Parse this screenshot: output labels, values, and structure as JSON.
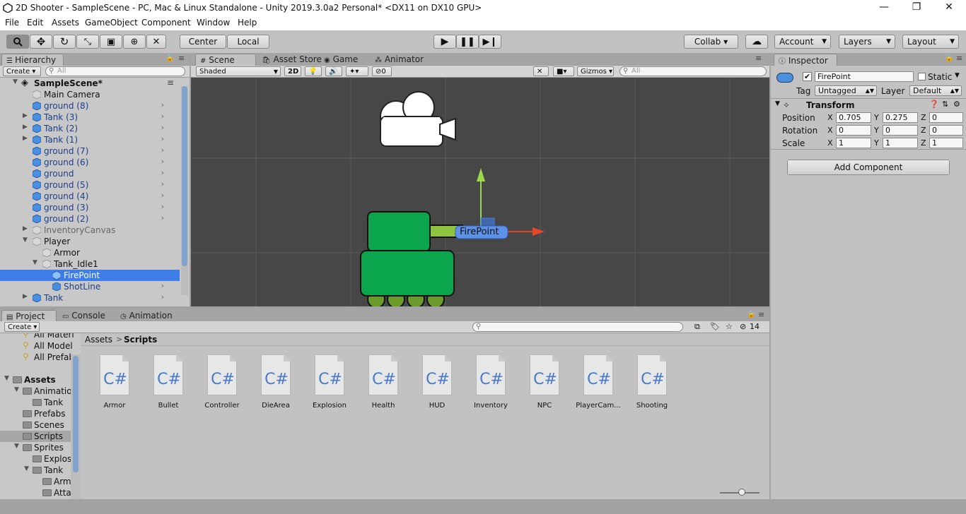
{
  "window": {
    "title": "2D Shooter - SampleScene - PC, Mac & Linux Standalone - Unity 2019.3.0a2 Personal* <DX11 on DX10 GPU>",
    "minimize": "—",
    "maximize": "❐",
    "close": "✕"
  },
  "menu": [
    "File",
    "Edit",
    "Assets",
    "GameObject",
    "Component",
    "Window",
    "Help"
  ],
  "toolbar": {
    "pivot_mode": "Center",
    "pivot_rotation": "Local",
    "collab": "Collab ▾",
    "account": "Account",
    "layers": "Layers",
    "layout": "Layout"
  },
  "hierarchy": {
    "tab": "Hierarchy",
    "create": "Create ▾",
    "search_placeholder": "All",
    "scene": "SampleScene*",
    "items": [
      {
        "label": "Main Camera"
      },
      {
        "label": "ground (8)"
      },
      {
        "label": "Tank (3)"
      },
      {
        "label": "Tank (2)"
      },
      {
        "label": "Tank (1)"
      },
      {
        "label": "ground (7)"
      },
      {
        "label": "ground (6)"
      },
      {
        "label": "ground"
      },
      {
        "label": "ground (5)"
      },
      {
        "label": "ground (4)"
      },
      {
        "label": "ground (3)"
      },
      {
        "label": "ground (2)"
      },
      {
        "label": "InventoryCanvas"
      },
      {
        "label": "Player"
      },
      {
        "label": "Armor"
      },
      {
        "label": "Tank_Idle1"
      },
      {
        "label": "FirePoint"
      },
      {
        "label": "ShotLine"
      },
      {
        "label": "Tank"
      }
    ]
  },
  "scene_view": {
    "tabs": [
      "Scene",
      "Asset Store",
      "Game",
      "Animator"
    ],
    "shading": "Shaded",
    "mode_2d": "2D",
    "gizmos": "Gizmos ▾",
    "search_placeholder": "All",
    "hidden_count": "0",
    "selected_label": "FirePoint"
  },
  "inspector": {
    "tab": "Inspector",
    "name": "FirePoint",
    "static": "Static",
    "tag_label": "Tag",
    "tag": "Untagged",
    "layer_label": "Layer",
    "layer": "Default",
    "component": "Transform",
    "rows": [
      {
        "label": "Position",
        "x": "0.705",
        "y": "0.275",
        "z": "0"
      },
      {
        "label": "Rotation",
        "x": "0",
        "y": "0",
        "z": "0"
      },
      {
        "label": "Scale",
        "x": "1",
        "y": "1",
        "z": "1"
      }
    ],
    "axis": {
      "x": "X",
      "y": "Y",
      "z": "Z"
    },
    "add_component": "Add Component"
  },
  "project": {
    "tabs": [
      "Project",
      "Console",
      "Animation"
    ],
    "create": "Create ▾",
    "hidden_count": "14",
    "favorites": [
      "All Materi",
      "All Model",
      "All Prefab"
    ],
    "tree": [
      {
        "label": "Assets"
      },
      {
        "label": "Animation"
      },
      {
        "label": "Tank"
      },
      {
        "label": "Prefabs"
      },
      {
        "label": "Scenes"
      },
      {
        "label": "Scripts"
      },
      {
        "label": "Sprites"
      },
      {
        "label": "Explos"
      },
      {
        "label": "Tank"
      },
      {
        "label": "Arm"
      },
      {
        "label": "Atta"
      }
    ],
    "breadcrumb": {
      "root": "Assets",
      "sep": ">",
      "current": "Scripts"
    },
    "file_icon": "C#",
    "files": [
      "Armor",
      "Bullet",
      "Controller",
      "DieArea",
      "Explosion",
      "Health",
      "HUD",
      "Inventory",
      "NPC",
      "PlayerCam...",
      "Shooting"
    ]
  },
  "colors": {
    "selection": "#3e7de7",
    "scene_bg": "#474747",
    "tank_green": "#0aa54c",
    "cube_blue": "#4b8fe0"
  }
}
